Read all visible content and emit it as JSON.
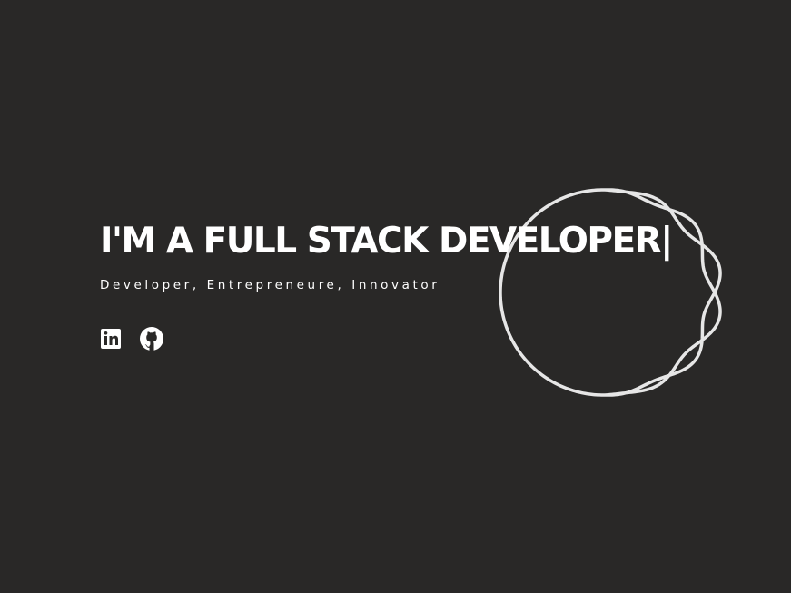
{
  "hero": {
    "headline": "I'M A FULL STACK DEVELOPER",
    "cursor": "|",
    "tagline": "Developer, Entrepreneure, Innovator"
  },
  "socials": [
    {
      "icon": "linkedin-icon"
    },
    {
      "icon": "github-icon"
    }
  ],
  "colors": {
    "background": "#292827",
    "text": "#ffffff",
    "ring": "#e6e6e6"
  }
}
